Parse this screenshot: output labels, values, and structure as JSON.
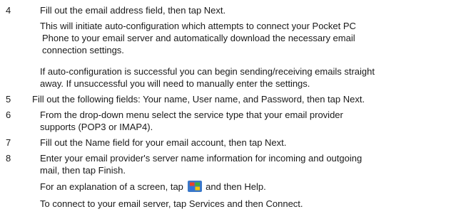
{
  "steps": [
    {
      "number": "4",
      "lines": [
        "Fill out the email address field, then tap Next."
      ],
      "paragraphs": [
        [
          "This will initiate auto-configuration which attempts to connect your Pocket PC",
          "Phone to your email server and automatically download the necessary email",
          "connection settings."
        ],
        [
          "If auto-configuration is successful you can begin sending/receiving emails straight",
          "away. If unsuccessful you will need to manually enter the settings."
        ]
      ]
    },
    {
      "number": "5",
      "lines": [
        "Fill out the following fields: Your name, User name, and Password, then tap Next."
      ]
    },
    {
      "number": "6",
      "lines": [
        "From the drop-down menu select the service type that your email provider",
        "supports (POP3 or IMAP4)."
      ]
    },
    {
      "number": "7",
      "lines": [
        "Fill out the Name field for your email account, then tap Next."
      ]
    },
    {
      "number": "8",
      "lines": [
        "Enter your email provider's server name information for incoming and outgoing",
        "mail, then tap Finish."
      ]
    }
  ],
  "notes": {
    "help_before": "For an explanation of a screen, tap",
    "help_after": "and then Help.",
    "help_icon": "windows-start-flag-icon",
    "connect": "To connect to your email server, tap Services and then Connect."
  }
}
